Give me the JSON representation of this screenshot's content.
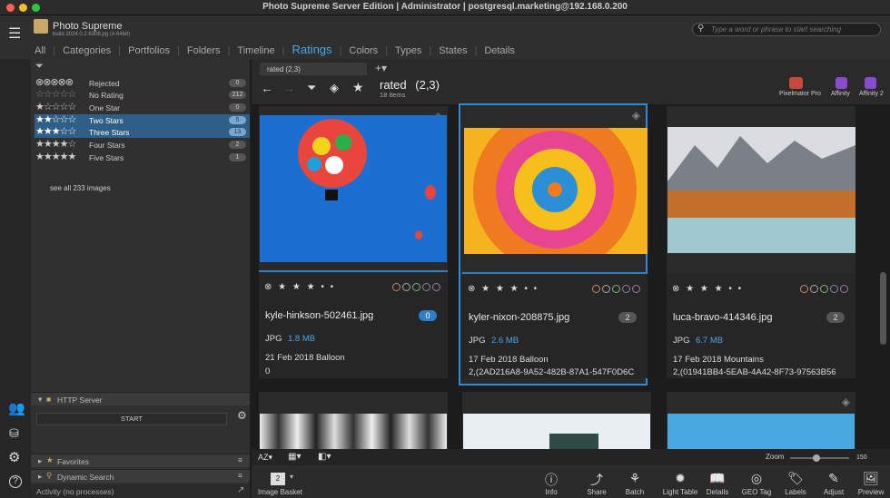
{
  "window": {
    "title": "Photo Supreme Server Edition | Administrator | postgresql.marketing@192.168.0.200"
  },
  "app": {
    "name": "Photo Supreme",
    "build": "build 2024.0.2.6308.pg (A 64bit)"
  },
  "search": {
    "placeholder": "Type a word or phrase to start searching"
  },
  "tabs": [
    "All",
    "Categories",
    "Portfolios",
    "Folders",
    "Timeline",
    "Ratings",
    "Colors",
    "Types",
    "States",
    "Details"
  ],
  "active_tab": "Ratings",
  "ratings": [
    {
      "stars": "⊗⊗⊗⊗⊗",
      "label": "Rejected",
      "count": "0"
    },
    {
      "stars": "☆☆☆☆☆",
      "label": "No Rating",
      "count": "212"
    },
    {
      "stars": "★☆☆☆☆",
      "label": "One Star",
      "count": "0"
    },
    {
      "stars": "★★☆☆☆",
      "label": "Two Stars",
      "count": "5"
    },
    {
      "stars": "★★★☆☆",
      "label": "Three Stars",
      "count": "13"
    },
    {
      "stars": "★★★★☆",
      "label": "Four Stars",
      "count": "2"
    },
    {
      "stars": "★★★★★",
      "label": "Five Stars",
      "count": "1"
    }
  ],
  "see_all": "see all 233 images",
  "query_tab": "rated  (2,3)",
  "result": {
    "title": "rated",
    "subtitle": "(2,3)",
    "count": "18 items"
  },
  "external_apps": [
    "Pixelmator Pro",
    "Affinity",
    "Affinity 2"
  ],
  "cards": [
    {
      "file": "kyle-hinkson-502461.jpg",
      "type": "JPG",
      "size": "1.8 MB",
      "date": "21 Feb 2018  Balloon",
      "id": "0",
      "badge": "0",
      "stars": "⊗ ★ ★ ★ • •"
    },
    {
      "file": "kyler-nixon-208875.jpg",
      "type": "JPG",
      "size": "2.6 MB",
      "date": "17 Feb 2018  Balloon",
      "id": "2,(2AD216A8-9A52-482B-87A1-547F0D6C",
      "badge": "2",
      "stars": "⊗ ★ ★ ★ • •"
    },
    {
      "file": "luca-bravo-414346.jpg",
      "type": "JPG",
      "size": "6.7 MB",
      "date": "17 Feb 2018  Mountains",
      "id": "2,(01941BB4-5EAB-4A42-8F73-97563B56",
      "badge": "2",
      "stars": "⊗ ★ ★ ★ • •"
    }
  ],
  "panels": {
    "http": "HTTP Server",
    "start": "START",
    "favorites": "Favorites",
    "dynamic": "Dynamic Search",
    "activity": "Activity (no processes)"
  },
  "bottom": {
    "basket": "Image Basket",
    "basket_count": "2",
    "zoom_label": "Zoom",
    "zoom_value": "150",
    "tools": [
      "Info",
      "Share",
      "Batch",
      "Light Table",
      "Details",
      "GEO Tag",
      "Labels",
      "Adjust",
      "Preview"
    ]
  }
}
